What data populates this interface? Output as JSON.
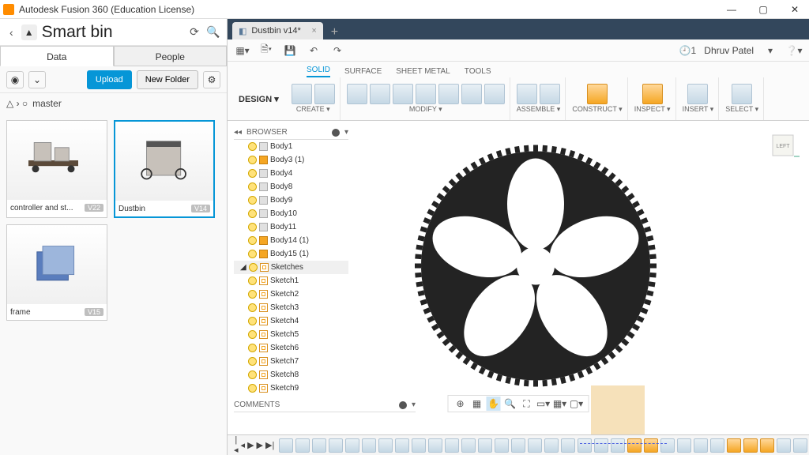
{
  "window": {
    "title": "Autodesk Fusion 360 (Education License)"
  },
  "sidebar": {
    "title": "Smart bin",
    "tabs": {
      "data": "Data",
      "people": "People"
    },
    "upload": "Upload",
    "newfolder": "New Folder",
    "master": "master",
    "cards": [
      {
        "label": "controller and st...",
        "ver": "V22"
      },
      {
        "label": "Dustbin",
        "ver": "V14"
      },
      {
        "label": "frame",
        "ver": "V15"
      }
    ]
  },
  "docTab": {
    "name": "Dustbin v14*"
  },
  "user": "Dhruv Patel",
  "ribbon": {
    "design": "DESIGN",
    "tabs": {
      "solid": "SOLID",
      "surface": "SURFACE",
      "sheet": "SHEET METAL",
      "tools": "TOOLS"
    },
    "groups": {
      "create": "CREATE",
      "modify": "MODIFY",
      "assemble": "ASSEMBLE",
      "construct": "CONSTRUCT",
      "inspect": "INSPECT",
      "insert": "INSERT",
      "select": "SELECT"
    }
  },
  "browser": {
    "header": "BROWSER",
    "bodies": [
      "Body1",
      "Body3 (1)",
      "Body4",
      "Body8",
      "Body9",
      "Body10",
      "Body11",
      "Body14 (1)",
      "Body15 (1)"
    ],
    "sketchesLabel": "Sketches",
    "sketches": [
      "Sketch1",
      "Sketch2",
      "Sketch3",
      "Sketch4",
      "Sketch5",
      "Sketch6",
      "Sketch7",
      "Sketch8",
      "Sketch9"
    ]
  },
  "comments": "COMMENTS",
  "viewcube": "LEFT",
  "history": "1"
}
